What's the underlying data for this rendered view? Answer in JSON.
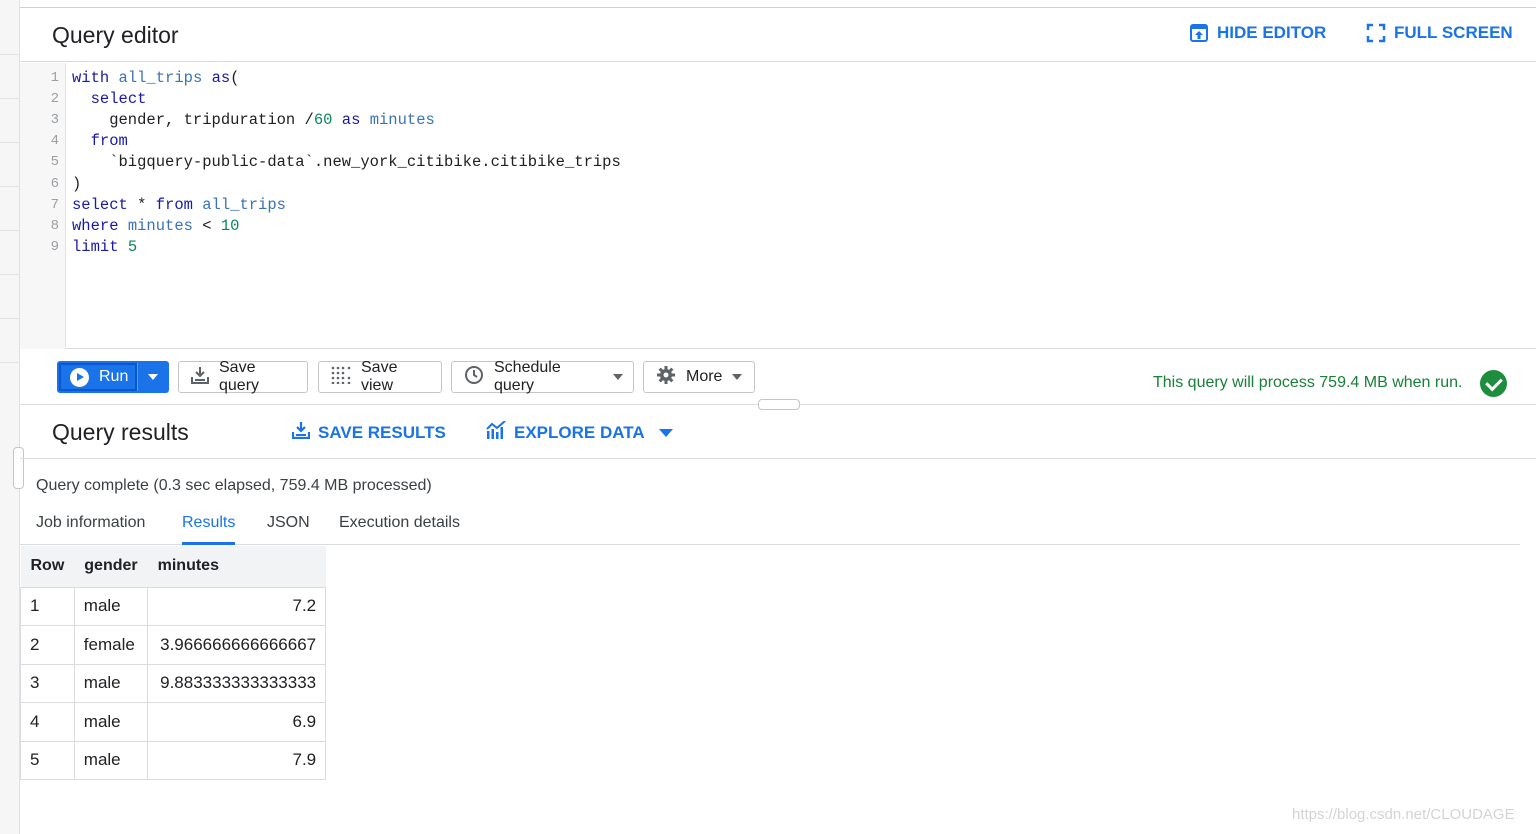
{
  "editor": {
    "title": "Query editor",
    "hide_editor_label": "HIDE EDITOR",
    "full_screen_label": "FULL SCREEN",
    "line_numbers": [
      "1",
      "2",
      "3",
      "4",
      "5",
      "6",
      "7",
      "8",
      "9"
    ],
    "code_lines": [
      "with all_trips as(",
      "  select",
      "    gender, tripduration /60 as minutes",
      "  from",
      "    `bigquery-public-data`.new_york_citibike.citibike_trips",
      ")",
      "select * from all_trips",
      "where minutes < 10",
      "limit 5"
    ]
  },
  "toolbar": {
    "run_label": "Run",
    "save_query_label": "Save query",
    "save_view_label": "Save view",
    "schedule_query_label": "Schedule query",
    "more_label": "More",
    "validation_message": "This query will process 759.4 MB when run."
  },
  "results": {
    "title": "Query results",
    "save_results_label": "SAVE RESULTS",
    "explore_data_label": "EXPLORE DATA",
    "status": "Query complete (0.3 sec elapsed, 759.4 MB processed)",
    "tabs": [
      "Job information",
      "Results",
      "JSON",
      "Execution details"
    ],
    "active_tab": "Results",
    "columns": [
      "Row",
      "gender",
      "minutes"
    ],
    "rows": [
      [
        "1",
        "male",
        "7.2"
      ],
      [
        "2",
        "female",
        "3.966666666666667"
      ],
      [
        "3",
        "male",
        "9.883333333333333"
      ],
      [
        "4",
        "male",
        "6.9"
      ],
      [
        "5",
        "male",
        "7.9"
      ]
    ]
  },
  "watermark": "https://blog.csdn.net/CLOUDAGE",
  "colors": {
    "accent": "#1a73e8",
    "success": "#188038",
    "keyword": "#1a1aa6",
    "identifier": "#3a72b8",
    "number": "#098658"
  },
  "icons": [
    "hide-editor-icon",
    "full-screen-icon",
    "play-icon",
    "save-icon",
    "grid-icon",
    "clock-icon",
    "gear-icon",
    "check-circle-icon",
    "download-icon",
    "chart-icon",
    "chevron-down-icon"
  ]
}
